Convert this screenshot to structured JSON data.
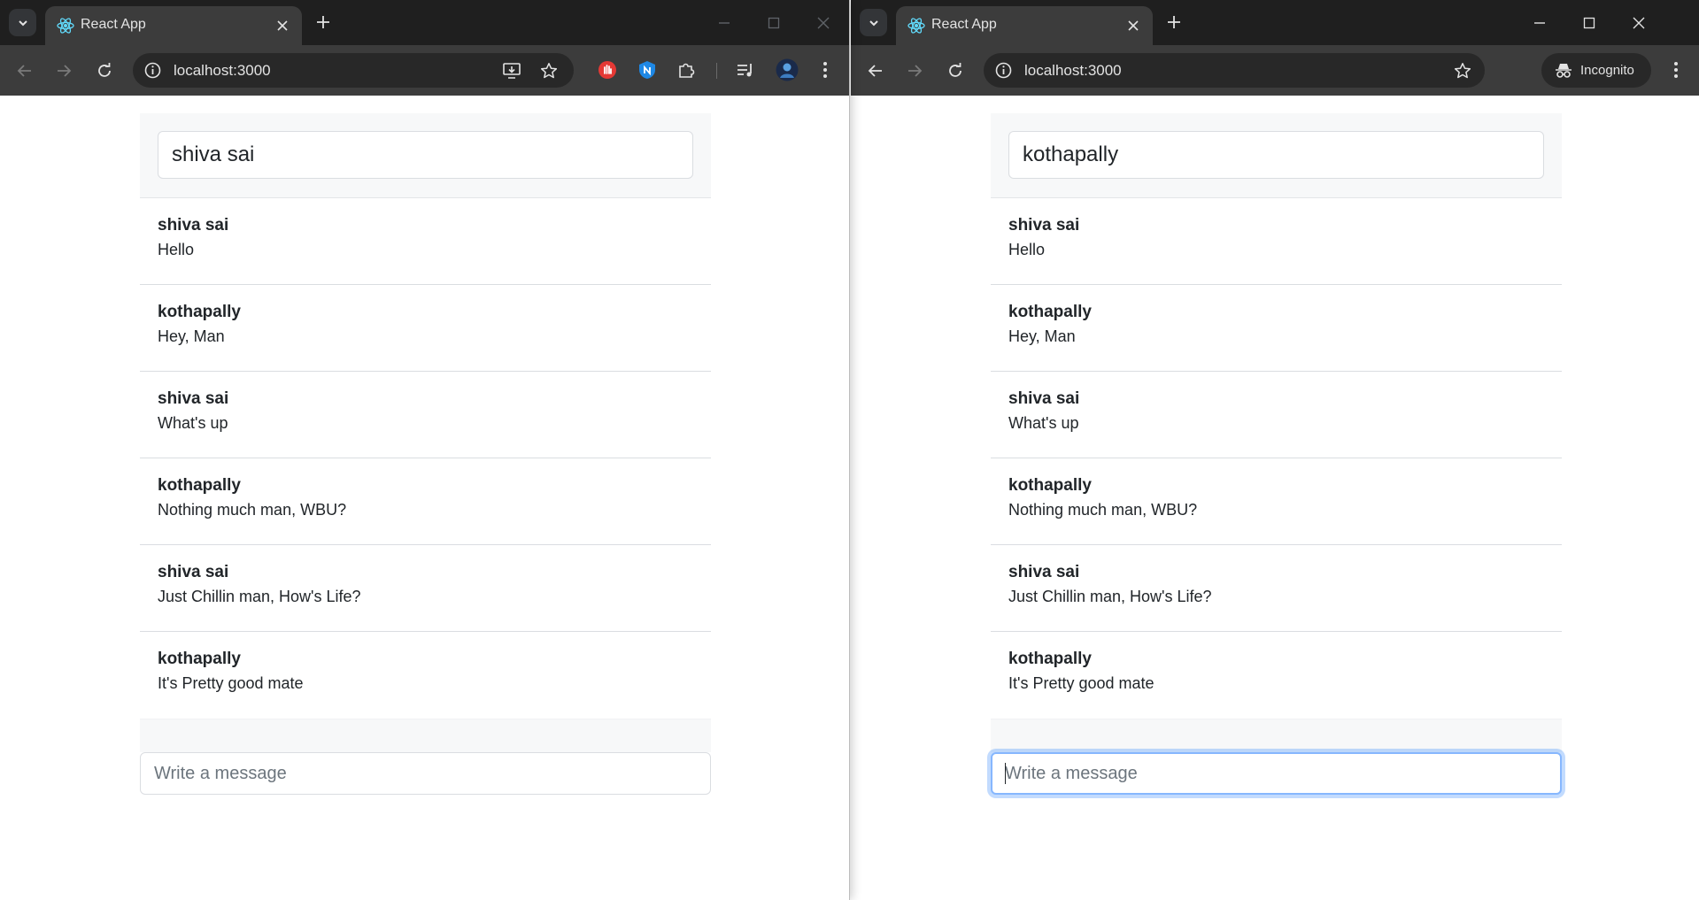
{
  "colors": {
    "chrome_titlebar": "#1f1f1f",
    "chrome_toolbar": "#3c3c3c",
    "omnibox": "#282828",
    "page_panel": "#f7f8f9",
    "focus_ring": "#86b7fe"
  },
  "left_window": {
    "tab_title": "React App",
    "url": "localhost:3000",
    "name_input_value": "shiva sai",
    "message_placeholder": "Write a message",
    "messages": [
      {
        "author": "shiva sai",
        "text": "Hello"
      },
      {
        "author": "kothapally",
        "text": "Hey, Man"
      },
      {
        "author": "shiva sai",
        "text": "What's up"
      },
      {
        "author": "kothapally",
        "text": "Nothing much man, WBU?"
      },
      {
        "author": "shiva sai",
        "text": "Just Chillin man, How's Life?"
      },
      {
        "author": "kothapally",
        "text": "It's Pretty good mate"
      }
    ],
    "icons": [
      "tab-search-icon",
      "react-icon",
      "close-icon",
      "plus-icon",
      "minimize-icon",
      "maximize-icon",
      "back-icon",
      "forward-icon",
      "reload-icon",
      "info-icon",
      "install-app-icon",
      "star-icon",
      "hand-extension-icon",
      "shield-extension-icon",
      "puzzle-icon",
      "media-queue-icon",
      "avatar",
      "kebab-menu-icon"
    ]
  },
  "right_window": {
    "tab_title": "React App",
    "url": "localhost:3000",
    "incognito_label": "Incognito",
    "name_input_value": "kothapally",
    "message_placeholder": "Write a message",
    "messages": [
      {
        "author": "shiva sai",
        "text": "Hello"
      },
      {
        "author": "kothapally",
        "text": "Hey, Man"
      },
      {
        "author": "shiva sai",
        "text": "What's up"
      },
      {
        "author": "kothapally",
        "text": "Nothing much man, WBU?"
      },
      {
        "author": "shiva sai",
        "text": "Just Chillin man, How's Life?"
      },
      {
        "author": "kothapally",
        "text": "It's Pretty good mate"
      }
    ],
    "icons": [
      "tab-search-icon",
      "react-icon",
      "close-icon",
      "plus-icon",
      "minimize-icon",
      "maximize-icon",
      "back-icon",
      "forward-icon",
      "reload-icon",
      "info-icon",
      "star-icon",
      "incognito-icon",
      "kebab-menu-icon"
    ]
  }
}
